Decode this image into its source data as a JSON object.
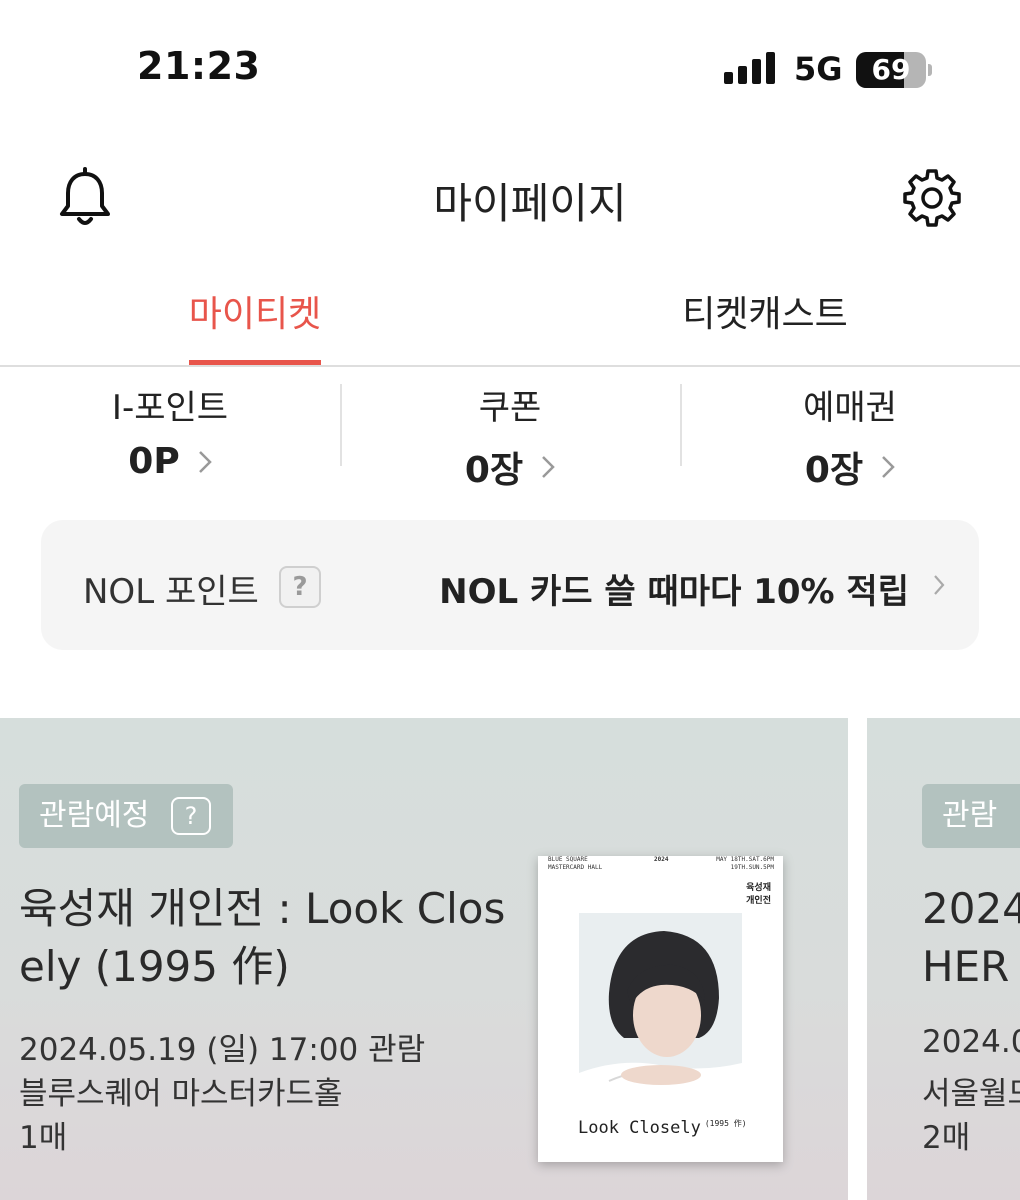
{
  "status_bar": {
    "time": "21:23",
    "network": "5G",
    "battery": "69",
    "battery_level": 0.69
  },
  "header": {
    "title": "마이페이지"
  },
  "tabs": [
    {
      "label": "마이티켓",
      "active": true
    },
    {
      "label": "티켓캐스트",
      "active": false
    }
  ],
  "stats": [
    {
      "label": "I-포인트",
      "value": "0P"
    },
    {
      "label": "쿠폰",
      "value": "0장"
    },
    {
      "label": "예매권",
      "value": "0장"
    }
  ],
  "nol": {
    "label": "NOL 포인트",
    "help": "?",
    "promo": "NOL 카드 쓸 때마다 10% 적립"
  },
  "tickets": [
    {
      "status": "관람예정",
      "help": "?",
      "title": "육성재 개인전 : Look Closely (1995 作)",
      "datetime": "2024.05.19 (일)  17:00 관람",
      "venue": "블루스퀘어 마스터카드홀",
      "quantity": "1매",
      "poster": {
        "venue_line1": "BLUE SQUARE",
        "venue_line2": "MASTERCARD HALL",
        "year": "2024",
        "date_line1": "MAY 18TH.SAT.6PM",
        "date_line2": "19TH.SUN.5PM",
        "name_line1": "육성재",
        "name_line2": "개인전",
        "caption": "Look Closely",
        "caption_year": "(1995 作)"
      }
    },
    {
      "status": "관람",
      "title_line1": "2024",
      "title_line2": "HER",
      "datetime": "2024.0",
      "venue": "서울월드",
      "quantity": "2매"
    }
  ],
  "colors": {
    "accent": "#e8554b",
    "badge": "#b3c2bf",
    "card_top": "#d6dedc",
    "card_bottom": "#dcd5d8"
  }
}
